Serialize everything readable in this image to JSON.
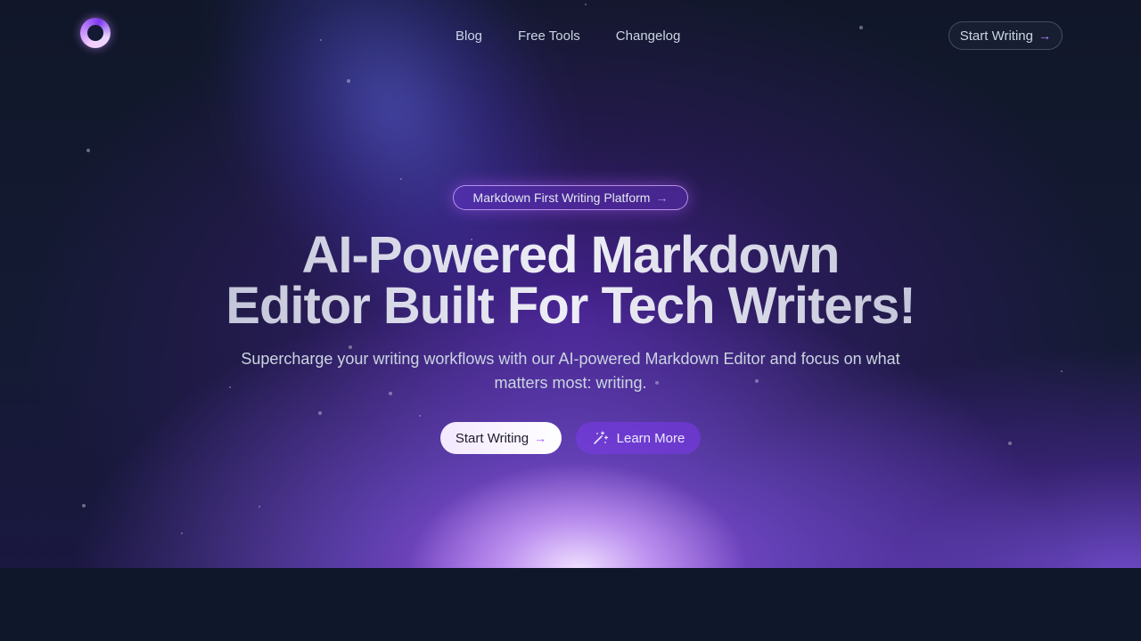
{
  "nav": {
    "links": [
      {
        "label": "Blog"
      },
      {
        "label": "Free Tools"
      },
      {
        "label": "Changelog"
      }
    ],
    "cta_label": "Start Writing",
    "logo_icon": "ring-logo-icon"
  },
  "hero": {
    "badge_label": "Markdown First Writing Platform",
    "headline_line1": "AI-Powered Markdown",
    "headline_line2": "Editor Built For Tech Writers!",
    "subtitle": "Supercharge your writing workflows with our AI-powered Markdown Editor and focus on what matters most: writing.",
    "primary_label": "Start Writing",
    "secondary_label": "Learn More",
    "secondary_icon": "magic-wand-icon"
  },
  "colors": {
    "background": "#0f172a",
    "accent": "#a855f7",
    "glow": "#c084fc"
  }
}
